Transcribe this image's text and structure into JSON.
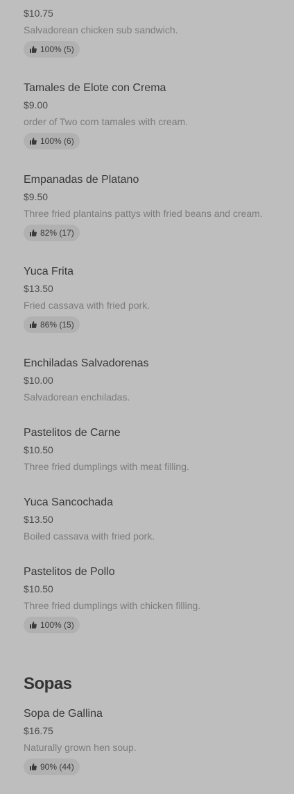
{
  "items": [
    {
      "price": "$10.75",
      "description": "Salvadorean chicken sub sandwich.",
      "rating": "100% (5)"
    },
    {
      "name": "Tamales de Elote con Crema",
      "price": "$9.00",
      "description": "order of Two corn tamales with cream.",
      "rating": "100% (6)"
    },
    {
      "name": "Empanadas de Platano",
      "price": "$9.50",
      "description": "Three fried plantains pattys with fried beans and cream.",
      "rating": "82% (17)"
    },
    {
      "name": "Yuca Frita",
      "price": "$13.50",
      "description": "Fried cassava with fried pork.",
      "rating": "86% (15)"
    },
    {
      "name": "Enchiladas Salvadorenas",
      "price": "$10.00",
      "description": "Salvadorean enchiladas."
    },
    {
      "name": "Pastelitos de Carne",
      "price": "$10.50",
      "description": "Three fried dumplings with meat filling."
    },
    {
      "name": "Yuca Sancochada",
      "price": "$13.50",
      "description": "Boiled cassava with fried pork."
    },
    {
      "name": "Pastelitos de Pollo",
      "price": "$10.50",
      "description": "Three fried dumplings with chicken filling.",
      "rating": "100% (3)"
    }
  ],
  "sections": [
    {
      "title": "Sopas"
    }
  ],
  "sopas_items": [
    {
      "name": "Sopa de Gallina",
      "price": "$16.75",
      "description": "Naturally grown hen soup.",
      "rating": "90% (44)"
    }
  ],
  "icons": {
    "rating": "thumbs-up-icon"
  },
  "colors": {
    "background": "#bebebe",
    "rating_pill": "#b1b1b1",
    "title_text": "#383838",
    "description_text": "#7b7b7b"
  }
}
